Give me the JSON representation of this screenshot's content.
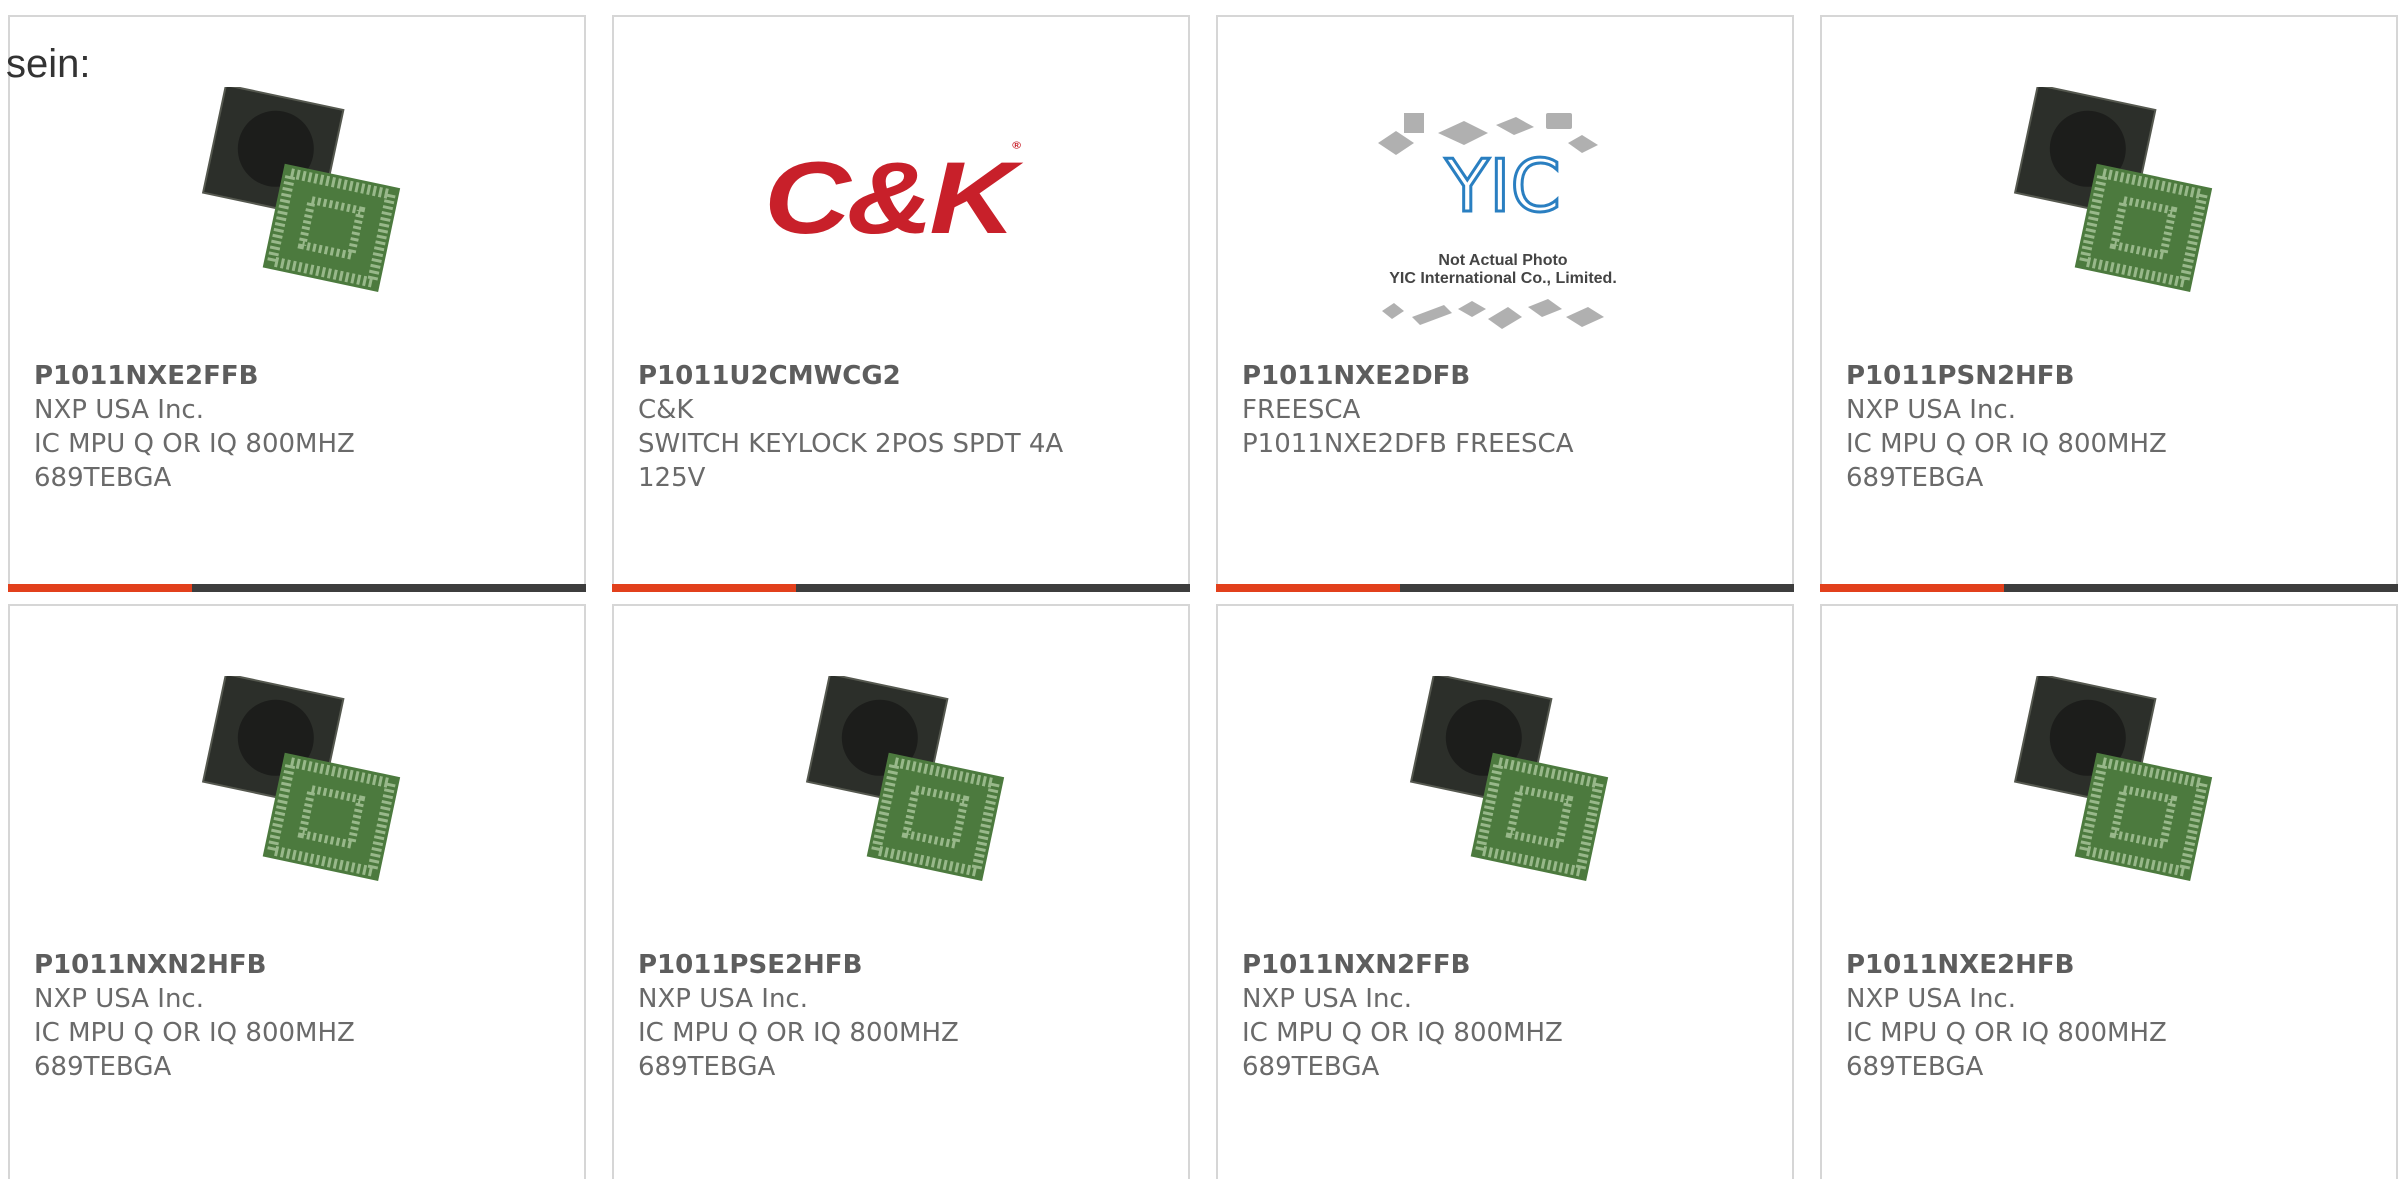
{
  "intro_text": "sein:",
  "colors": {
    "accent": "#e2401c",
    "bar": "#3d3d3d",
    "border": "#d6d6d6"
  },
  "products": [
    {
      "part": "P1011NXE2FFB",
      "maker": "NXP USA Inc.",
      "desc": "IC MPU Q OR IQ 800MHZ",
      "desc2": "689TEBGA",
      "image": "bga-chip-icon"
    },
    {
      "part": "P1011U2CMWCG2",
      "maker": "C&K",
      "desc": "SWITCH KEYLOCK 2POS SPDT 4A",
      "desc2": "125V",
      "image": "ck-logo",
      "logo_text": "C&K"
    },
    {
      "part": "P1011NXE2DFB",
      "maker": "FREESCA",
      "desc": "P1011NXE2DFB FREESCA",
      "desc2": "",
      "image": "placeholder-photo",
      "placeholder_line1": "Not Actual Photo",
      "placeholder_line2": "YIC International Co., Limited.",
      "placeholder_logo": "YIC"
    },
    {
      "part": "P1011PSN2HFB",
      "maker": "NXP USA Inc.",
      "desc": "IC MPU Q OR IQ 800MHZ",
      "desc2": "689TEBGA",
      "image": "bga-chip-icon"
    },
    {
      "part": "P1011NXN2HFB",
      "maker": "NXP USA Inc.",
      "desc": "IC MPU Q OR IQ 800MHZ",
      "desc2": "689TEBGA",
      "image": "bga-chip-icon"
    },
    {
      "part": "P1011PSE2HFB",
      "maker": "NXP USA Inc.",
      "desc": "IC MPU Q OR IQ 800MHZ",
      "desc2": "689TEBGA",
      "image": "bga-chip-icon"
    },
    {
      "part": "P1011NXN2FFB",
      "maker": "NXP USA Inc.",
      "desc": "IC MPU Q OR IQ 800MHZ",
      "desc2": "689TEBGA",
      "image": "bga-chip-icon"
    },
    {
      "part": "P1011NXE2HFB",
      "maker": "NXP USA Inc.",
      "desc": "IC MPU Q OR IQ 800MHZ",
      "desc2": "689TEBGA",
      "image": "bga-chip-icon"
    }
  ]
}
